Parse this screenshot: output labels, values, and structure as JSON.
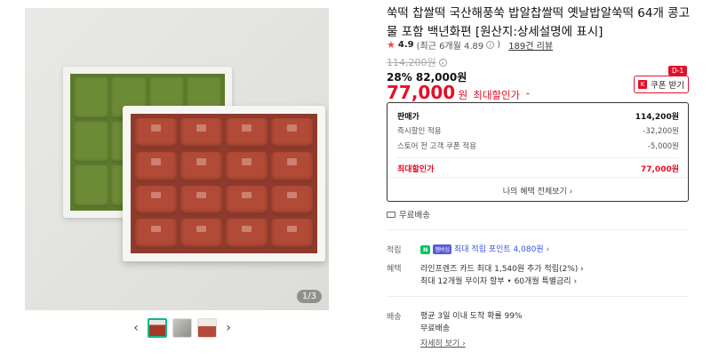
{
  "gallery": {
    "page_indicator": "1/3",
    "prev_label": "‹",
    "next_label": "›"
  },
  "product": {
    "title": "쑥떡 찹쌀떡 국산해풍쑥 밥알찹쌀떡 옛날밥알쑥떡 64개 콩고물 포함 백년화편 [원산지:상세설명에 표시]",
    "rating": "4.9",
    "rating_detail": "(최근 6개월 4.89",
    "rating_detail_close": ")",
    "review_count": "189건 리뷰",
    "original_price": "114,200원",
    "discount_rate": "28%",
    "discount_price": "82,000원",
    "final_price": "77,000",
    "final_unit": "원",
    "final_label": "최대할인가"
  },
  "coupon": {
    "badge": "D-1",
    "icon": "K",
    "label": "쿠폰 받기"
  },
  "price_box": {
    "rows": [
      {
        "label": "판매가",
        "value": "114,200원"
      },
      {
        "label": "즉시할인 적용",
        "value": "-32,200원"
      },
      {
        "label": "스토어 전 고객 쿠폰 적용",
        "value": "-5,000원"
      }
    ],
    "total_label": "최대할인가",
    "total_value": "77,000원",
    "benefits_link": "나의 혜택 전체보기 ›"
  },
  "shipping_tag": "무료배송",
  "points": {
    "label": "적립",
    "badge": "N",
    "badge2": "멤버십",
    "text": "최대 적립 포인트 4,080원 ›"
  },
  "benefits": {
    "label": "혜택",
    "line1": "라인프렌즈 카드 최대 1,540원 추가 적립(2%) ›",
    "line2": "최대 12개월 무이자 할부 • 60개월 특별금리 ›"
  },
  "delivery": {
    "label": "배송",
    "line1": "평균 3일 이내 도착 확률 99%",
    "line2": "무료배송",
    "more_link": "자세히 보기 ›"
  }
}
